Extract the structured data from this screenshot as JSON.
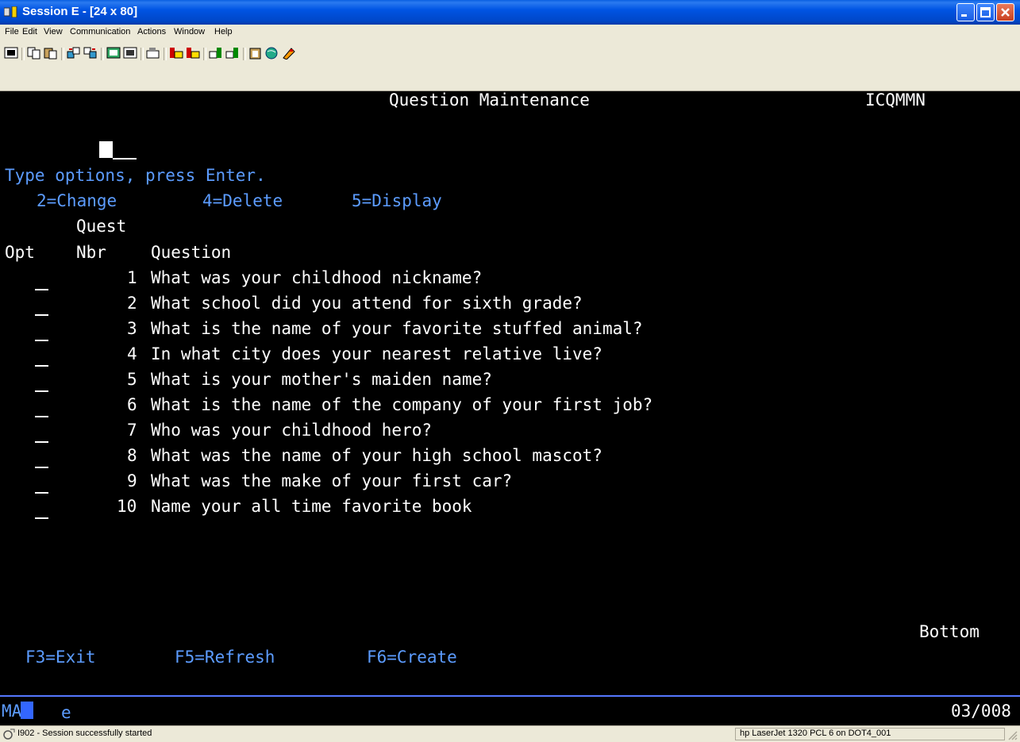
{
  "window": {
    "title": "Session E - [24 x 80]"
  },
  "menu": [
    "File",
    "Edit",
    "View",
    "Communication",
    "Actions",
    "Window",
    "Help"
  ],
  "toolbar_icons": [
    "print-screen-icon",
    "copy-icon",
    "paste-icon",
    "send-file-icon",
    "receive-file-icon",
    "display-icon",
    "keyboard-icon",
    "macro-icon",
    "record-macro-icon",
    "stop-macro-icon",
    "play-macro-icon",
    "transfer-icon",
    "clipboard-icon",
    "globe-icon",
    "help-icon"
  ],
  "screen": {
    "title": "Question Maintenance",
    "program": "ICQMMN",
    "instructions": "Type options, press Enter.",
    "opt_change": "2=Change",
    "opt_delete": "4=Delete",
    "opt_display": "5=Display",
    "col_quest": "Quest",
    "col_opt": "Opt",
    "col_nbr": "Nbr",
    "col_question": "Question",
    "rows": [
      {
        "nbr": "1",
        "question": "What was your childhood nickname?"
      },
      {
        "nbr": "2",
        "question": "What school did you attend for sixth grade?"
      },
      {
        "nbr": "3",
        "question": "What is the name of your favorite stuffed animal?"
      },
      {
        "nbr": "4",
        "question": "In what city does your nearest relative live?"
      },
      {
        "nbr": "5",
        "question": "What is your mother's maiden name?"
      },
      {
        "nbr": "6",
        "question": "What is the name of the company of your first job?"
      },
      {
        "nbr": "7",
        "question": "Who was your childhood hero?"
      },
      {
        "nbr": "8",
        "question": "What was the name of your high school mascot?"
      },
      {
        "nbr": "9",
        "question": "What was the make of your first car?"
      },
      {
        "nbr": "10",
        "question": "Name your all time favorite book"
      }
    ],
    "bottom": "Bottom",
    "f3": "F3=Exit",
    "f5": "F5=Refresh",
    "f6": "F6=Create"
  },
  "oia": {
    "mode": "MA",
    "indicator": "e",
    "position": "03/008"
  },
  "status": {
    "message": "I902 - Session successfully started",
    "printer": "hp LaserJet 1320 PCL 6 on DOT4_001"
  },
  "colors": {
    "text_white": "#ffffff",
    "text_blue": "#5c9cff",
    "background": "#000000",
    "titlebar": "#0054e3"
  }
}
